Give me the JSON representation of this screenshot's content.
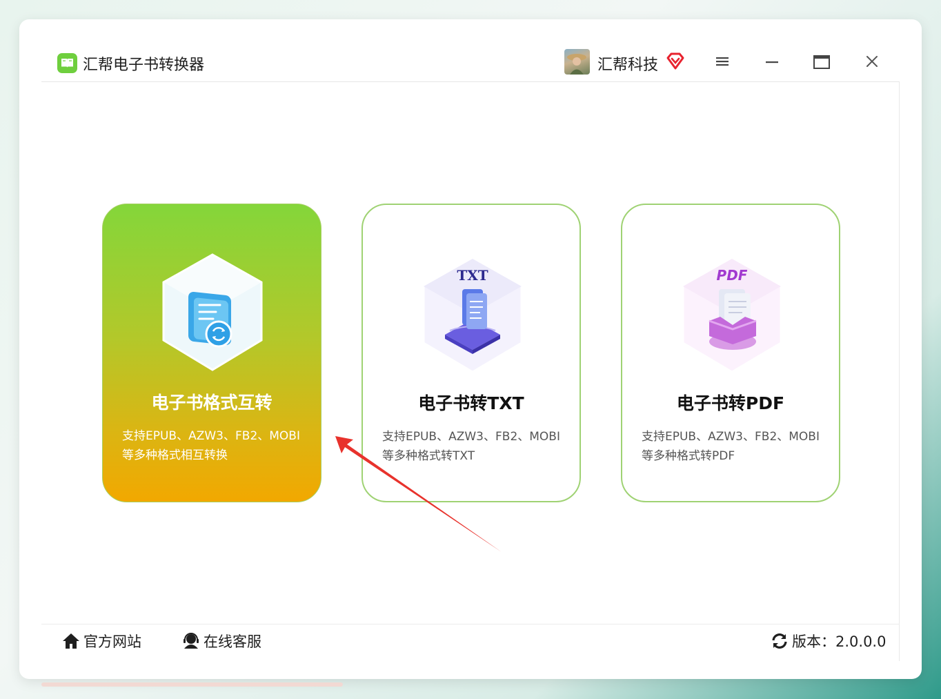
{
  "app": {
    "title": "汇帮电子书转换器"
  },
  "user": {
    "name": "汇帮科技"
  },
  "window_controls": {
    "menu": "menu-icon",
    "minimize": "minimize-icon",
    "maximize": "maximize-icon",
    "close": "close-icon"
  },
  "cards": [
    {
      "title": "电子书格式互转",
      "desc_line1": "支持EPUB、AZW3、FB2、MOBI",
      "desc_line2": "等多种格式相互转换",
      "icon": "convert-icon",
      "active": true
    },
    {
      "title": "电子书转TXT",
      "icon_label": "TXT",
      "desc_line1": "支持EPUB、AZW3、FB2、MOBI",
      "desc_line2": "等多种格式转TXT",
      "icon": "txt-icon",
      "active": false
    },
    {
      "title": "电子书转PDF",
      "icon_label": "PDF",
      "desc_line1": "支持EPUB、AZW3、FB2、MOBI",
      "desc_line2": "等多种格式转PDF",
      "icon": "pdf-icon",
      "active": false
    }
  ],
  "footer": {
    "website": "官方网站",
    "service": "在线客服",
    "version": "版本：2.0.0.0"
  },
  "colors": {
    "accent_green": "#84d63a",
    "accent_orange": "#f2a800",
    "border_green": "#9fd273",
    "arrow_red": "#e8322c"
  }
}
